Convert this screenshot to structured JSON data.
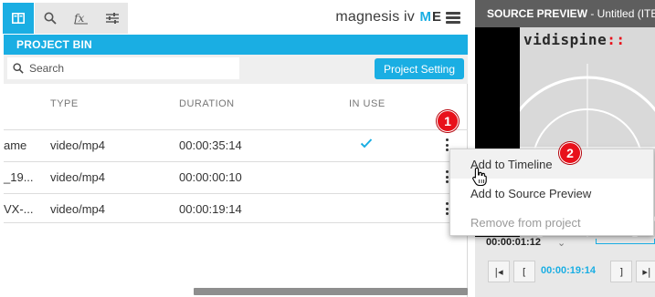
{
  "toolbar": {
    "tools": [
      {
        "icon": "bin-icon",
        "active": true
      },
      {
        "icon": "search-icon",
        "active": false
      },
      {
        "icon": "effects-icon",
        "active": false
      },
      {
        "icon": "sliders-icon",
        "active": false
      }
    ],
    "brand": "magnesis iv",
    "me_m": "M",
    "me_e": "E"
  },
  "bin": {
    "title": "PROJECT BIN",
    "search_placeholder": "Search",
    "settings_button": "Project Setting",
    "columns": {
      "type": "TYPE",
      "duration": "DURATION",
      "in_use": "IN USE"
    },
    "rows": [
      {
        "name": "ame",
        "type": "video/mp4",
        "duration": "00:00:35:14",
        "in_use": true
      },
      {
        "name": "_19...",
        "type": "video/mp4",
        "duration": "00:00:00:10",
        "in_use": false
      },
      {
        "name": "VX-...",
        "type": "video/mp4",
        "duration": "00:00:19:14",
        "in_use": false
      }
    ]
  },
  "badges": [
    "1",
    "2"
  ],
  "menu": {
    "items": [
      {
        "label": "Add to Timeline",
        "state": "hover"
      },
      {
        "label": "Add to Source Preview",
        "state": "normal"
      },
      {
        "label": "Remove from project",
        "state": "disabled"
      }
    ]
  },
  "preview": {
    "title_bold": "SOURCE PREVIEW",
    "title_rest": " - Untitled (ITEM",
    "logo_main": "vidispine",
    "logo_accent": "::",
    "timecode": "00:00:01:12",
    "controls_time": "00:00:19:14",
    "buttons": [
      "|◂",
      "[",
      "]",
      "▸|"
    ]
  },
  "colors": {
    "accent": "#1aaee3",
    "badge": "#e8111b"
  }
}
